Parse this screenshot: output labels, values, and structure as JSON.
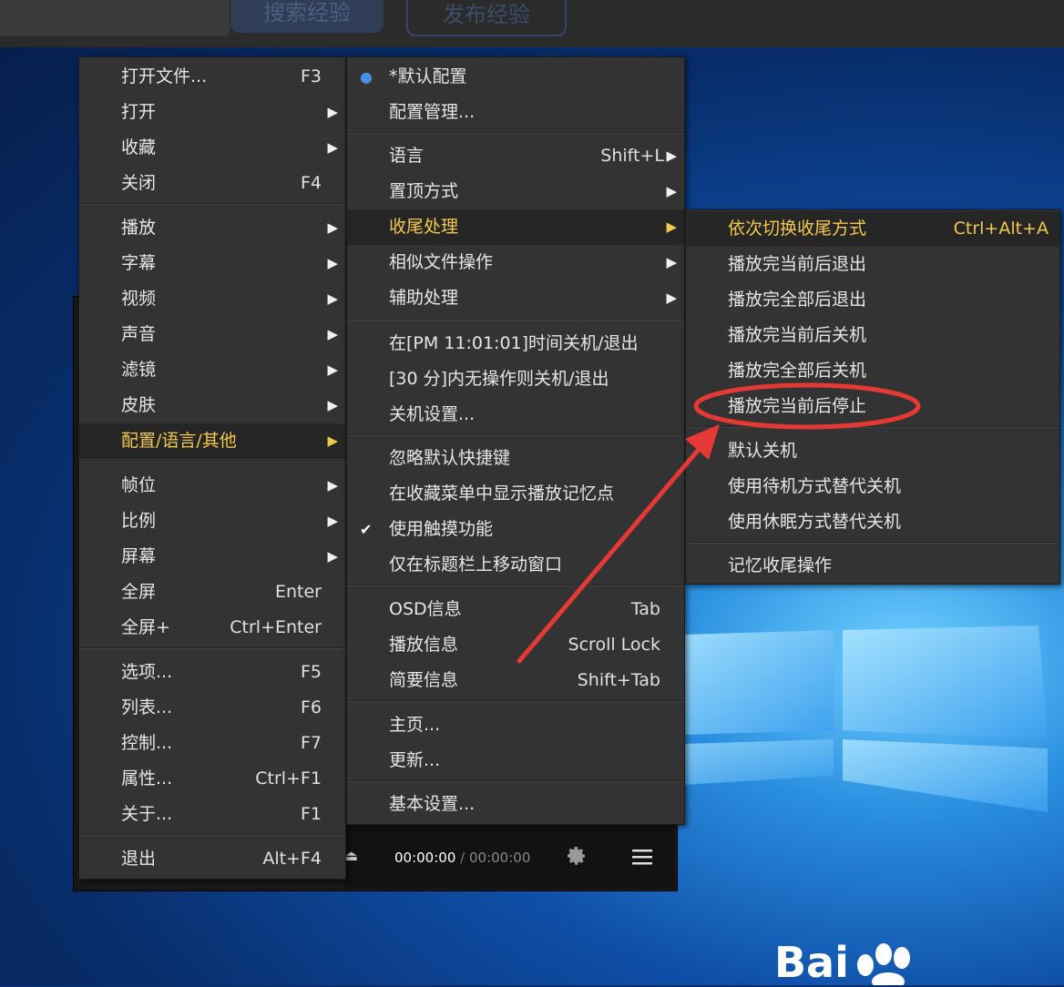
{
  "topbar": {
    "search_button": "搜索经验",
    "publish_button": "发布经验"
  },
  "player": {
    "time_current": "00:00:00",
    "time_separator": "/",
    "time_total": "00:00:00"
  },
  "main_menu": [
    {
      "label": "打开文件...",
      "shortcut": "F3"
    },
    {
      "label": "打开",
      "arrow": "▶"
    },
    {
      "label": "收藏",
      "arrow": "▶"
    },
    {
      "label": "关闭",
      "shortcut": "F4"
    },
    {
      "label": "播放",
      "arrow": "▶"
    },
    {
      "label": "字幕",
      "arrow": "▶"
    },
    {
      "label": "视频",
      "arrow": "▶"
    },
    {
      "label": "声音",
      "arrow": "▶"
    },
    {
      "label": "滤镜",
      "arrow": "▶"
    },
    {
      "label": "皮肤",
      "arrow": "▶"
    },
    {
      "label": "配置/语言/其他",
      "arrow": "▶"
    },
    {
      "label": "帧位",
      "arrow": "▶"
    },
    {
      "label": "比例",
      "arrow": "▶"
    },
    {
      "label": "屏幕",
      "arrow": "▶"
    },
    {
      "label": "全屏",
      "shortcut": "Enter"
    },
    {
      "label": "全屏+",
      "shortcut": "Ctrl+Enter"
    },
    {
      "label": "选项...",
      "shortcut": "F5"
    },
    {
      "label": "列表...",
      "shortcut": "F6"
    },
    {
      "label": "控制...",
      "shortcut": "F7"
    },
    {
      "label": "属性...",
      "shortcut": "Ctrl+F1"
    },
    {
      "label": "关于...",
      "shortcut": "F1"
    },
    {
      "label": "退出",
      "shortcut": "Alt+F4"
    }
  ],
  "config_menu": [
    {
      "label": "*默认配置"
    },
    {
      "label": "配置管理..."
    },
    {
      "label": "语言",
      "shortcut": "Shift+L",
      "arrow": "▶"
    },
    {
      "label": "置顶方式",
      "arrow": "▶"
    },
    {
      "label": "收尾处理",
      "arrow": "▶"
    },
    {
      "label": "相似文件操作",
      "arrow": "▶"
    },
    {
      "label": "辅助处理",
      "arrow": "▶"
    },
    {
      "label": "在[PM 11:01:01]时间关机/退出"
    },
    {
      "label": "[30 分]内无操作则关机/退出"
    },
    {
      "label": "关机设置..."
    },
    {
      "label": "忽略默认快捷键"
    },
    {
      "label": "在收藏菜单中显示播放记忆点"
    },
    {
      "label": "使用触摸功能"
    },
    {
      "label": "仅在标题栏上移动窗口"
    },
    {
      "label": "OSD信息",
      "shortcut": "Tab"
    },
    {
      "label": "播放信息",
      "shortcut": "Scroll Lock"
    },
    {
      "label": "简要信息",
      "shortcut": "Shift+Tab"
    },
    {
      "label": "主页..."
    },
    {
      "label": "更新..."
    },
    {
      "label": "基本设置..."
    }
  ],
  "ending_menu": [
    {
      "label": "依次切换收尾方式",
      "shortcut": "Ctrl+Alt+A"
    },
    {
      "label": "播放完当前后退出"
    },
    {
      "label": "播放完全部后退出"
    },
    {
      "label": "播放完当前后关机"
    },
    {
      "label": "播放完全部后关机"
    },
    {
      "label": "播放完当前后停止"
    },
    {
      "label": "默认关机"
    },
    {
      "label": "使用待机方式替代关机"
    },
    {
      "label": "使用休眠方式替代关机"
    },
    {
      "label": "记忆收尾操作"
    }
  ],
  "watermark": {
    "text": "Bai"
  },
  "colors": {
    "highlight_text": "#f2c94c",
    "annotation": "#e53935",
    "menu_bg": "#333333"
  }
}
